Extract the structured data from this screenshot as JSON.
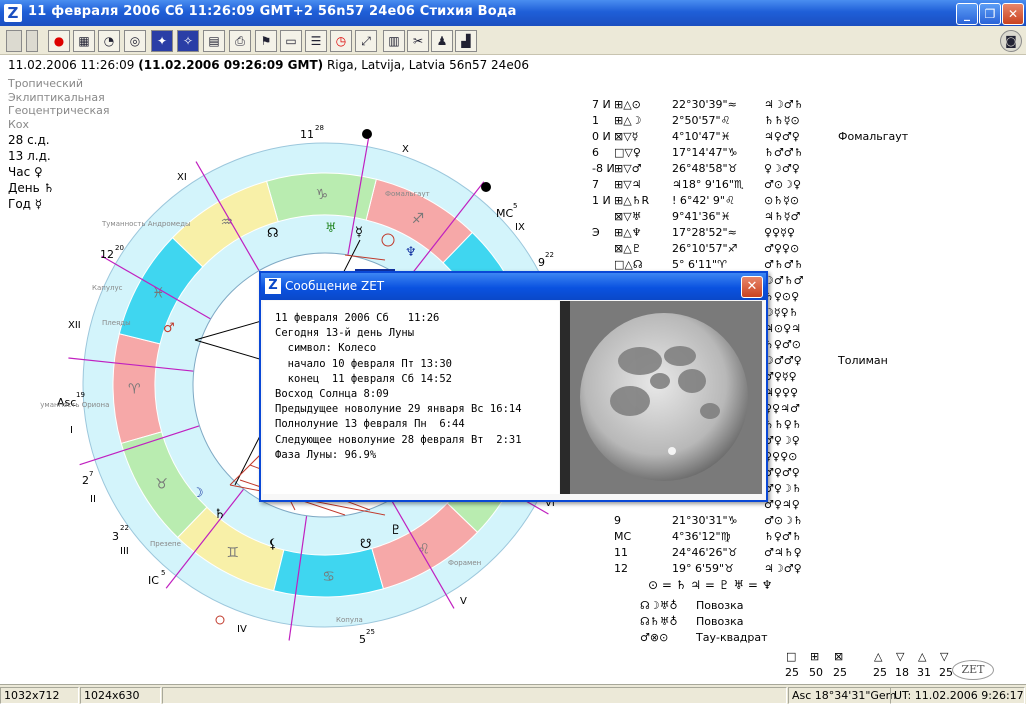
{
  "window": {
    "title": "11 февраля 2006  Сб  11:26:09 GMT+2 56n57  24e06   Стихия Вода",
    "app_icon": "Z"
  },
  "info": {
    "line_part1": "11.02.2006   11:26:09 ",
    "line_bold": "(11.02.2006  09:26:09 GMT)",
    "line_part2": " Riga, Latvija, Latvia 56n57  24e06"
  },
  "left_settings": [
    "Тропический",
    "Эклиптикальная",
    "Геоцентрическая",
    "Кох"
  ],
  "left_info": [
    "28 с.д.",
    "13 л.д.",
    "Час ♀",
    "День ♄",
    "Год ☿"
  ],
  "wheel": {
    "roman": [
      "X",
      "IX",
      "XI",
      "XII",
      "I",
      "II",
      "III",
      "IV",
      "V",
      "VI"
    ],
    "cusps": [
      "11",
      "12",
      "Asc",
      "2",
      "3",
      "IC",
      "5",
      "MC",
      "9"
    ],
    "cusp_sup": [
      "28",
      "20",
      "19",
      "7",
      "22",
      "5",
      "25",
      "5",
      "22"
    ],
    "stars": [
      "Фомальгаут",
      "Туманность Андромеды",
      "Капулус",
      "Плеяды",
      "Туманность Ориона",
      "Презепе",
      "Копула",
      "Форамен"
    ],
    "colors": {
      "fire": "#f6a8a8",
      "earth": "#b9ecb0",
      "air": "#f8f0a8",
      "water": "#3fd6f0",
      "ring": "#d3f4fb"
    }
  },
  "positions": [
    {
      "flags": "7 И",
      "aspects": "⊞△⊙",
      "value": "22°30'39\"≈",
      "rulers": "♃☽♂♄"
    },
    {
      "flags": "1",
      "aspects": "⊞△☽",
      "value": "2°50'57\"♌",
      "rulers": "♄♄☿⊙"
    },
    {
      "flags": "0 И",
      "aspects": "⊠▽☿",
      "value": "4°10'47\"♓",
      "rulers": "♃♀♂♀"
    },
    {
      "flags": "6",
      "aspects": "□▽♀",
      "value": "17°14'47\"♑",
      "rulers": "♄♂♂♄"
    },
    {
      "flags": "-8 И",
      "aspects": "⊞▽♂",
      "value": "26°48'58\"♉",
      "rulers": "♀☽♂♀"
    },
    {
      "flags": "7",
      "aspects": "⊞▽♃",
      "value": "♃18° 9'16\"♏",
      "rulers": "♂⊙☽♀"
    },
    {
      "flags": "1 И",
      "aspects": "⊞△♄R",
      "value": "! 6°42' 9\"♌",
      "rulers": "⊙♄☿⊙"
    },
    {
      "flags": "",
      "aspects": "⊠▽♅",
      "value": "9°41'36\"♓",
      "rulers": "♃♄☿♂"
    },
    {
      "flags": "Э",
      "aspects": "⊞△♆",
      "value": "17°28'52\"≈",
      "rulers": "♀♀☿♀"
    },
    {
      "flags": "",
      "aspects": "⊠△♇",
      "value": "26°10'57\"♐",
      "rulers": "♂♀♀⊙"
    },
    {
      "flags": "",
      "aspects": "□△☊",
      "value": "5° 6'11\"♈",
      "rulers": "♂♄♂♄"
    },
    {
      "flags": "",
      "aspects": "",
      "value": "",
      "rulers": "☽♂♄♂"
    },
    {
      "flags": "",
      "aspects": "",
      "value": "",
      "rulers": "♄♀⊙♀"
    },
    {
      "flags": "",
      "aspects": "",
      "value": "",
      "rulers": "☽☿♀♄"
    },
    {
      "flags": "",
      "aspects": "",
      "value": "",
      "rulers": "♃⊙♀♃"
    },
    {
      "flags": "",
      "aspects": "",
      "value": "",
      "rulers": "♄♀♂⊙"
    },
    {
      "flags": "",
      "aspects": "",
      "value": "",
      "rulers": "☽♂♂♀"
    },
    {
      "flags": "",
      "aspects": "",
      "value": "",
      "rulers": "♂♀☿♀"
    },
    {
      "flags": "",
      "aspects": "",
      "value": "",
      "rulers": "♃♀♀♀"
    },
    {
      "flags": "",
      "aspects": "",
      "value": "",
      "rulers": "♀♀♃♂"
    },
    {
      "flags": "",
      "aspects": "",
      "value": "",
      "rulers": "♄♄♀♄"
    },
    {
      "flags": "",
      "aspects": "",
      "value": "",
      "rulers": "♂♀☽♀"
    },
    {
      "flags": "",
      "aspects": "",
      "value": "",
      "rulers": "♀♀♀⊙"
    },
    {
      "flags": "",
      "aspects": "",
      "value": "",
      "rulers": "♂♀♂♀"
    },
    {
      "flags": "",
      "aspects": "",
      "value": "",
      "rulers": "♂♀☽♄"
    },
    {
      "flags": "",
      "aspects": "",
      "value": "",
      "rulers": "♂♀♃♀"
    },
    {
      "flags": "",
      "aspects": "9",
      "value": "21°30'31\"♑",
      "rulers": "♂⊙☽♄"
    },
    {
      "flags": "",
      "aspects": "MC",
      "value": "4°36'12\"♍",
      "rulers": "♄♀♂♄"
    },
    {
      "flags": "",
      "aspects": "11",
      "value": "24°46'26\"♉",
      "rulers": "♂♃♄♀"
    },
    {
      "flags": "",
      "aspects": "12",
      "value": "19° 6'59\"♉",
      "rulers": "♃☽♂♀"
    }
  ],
  "fixed_stars": {
    "row3": "Фомальгаут",
    "row17": "Толиман"
  },
  "formula": "⊙ = ♄  ♃ = ♇ ♅ = ♆",
  "configs": [
    {
      "sym": "☊☽♅♁",
      "label": "Повозка"
    },
    {
      "sym": "☊♄♅♁",
      "label": "Повозка"
    },
    {
      "sym": "♂⊗⊙",
      "label": "Тау-квадрат"
    }
  ],
  "aspect_counts": [
    {
      "sym": "□",
      "count": "25"
    },
    {
      "sym": "⊞",
      "count": "50"
    },
    {
      "sym": "⊠",
      "count": "25"
    },
    {
      "sym": "△",
      "count": "25"
    },
    {
      "sym": "▽",
      "count": "18"
    },
    {
      "sym": "△",
      "count": "31"
    },
    {
      "sym": "▽",
      "count": "25"
    }
  ],
  "zet_logo": "ZET",
  "dialog": {
    "title": "Сообщение ZET",
    "lines": [
      "11 февраля 2006 Сб   11:26",
      "Сегодня 13-й день Луны",
      "  символ: Колесо",
      "  начало 10 февраля Пт 13:30",
      "  конец  11 февраля Сб 14:52",
      "Восход Солнца 8:09",
      "Предыдущее новолуние 29 января Вс 16:14",
      "Полнолуние 13 февраля Пн  6:44",
      "Следующее новолуние 28 февраля Вт  2:31",
      "Фаза Луны: 96.9%"
    ]
  },
  "status": {
    "res1": "1032x712",
    "res2": "1024x630",
    "asc": "Asc  18°34'31\"Gem",
    "ut": "UT: 11.02.2006  9:26:17"
  }
}
